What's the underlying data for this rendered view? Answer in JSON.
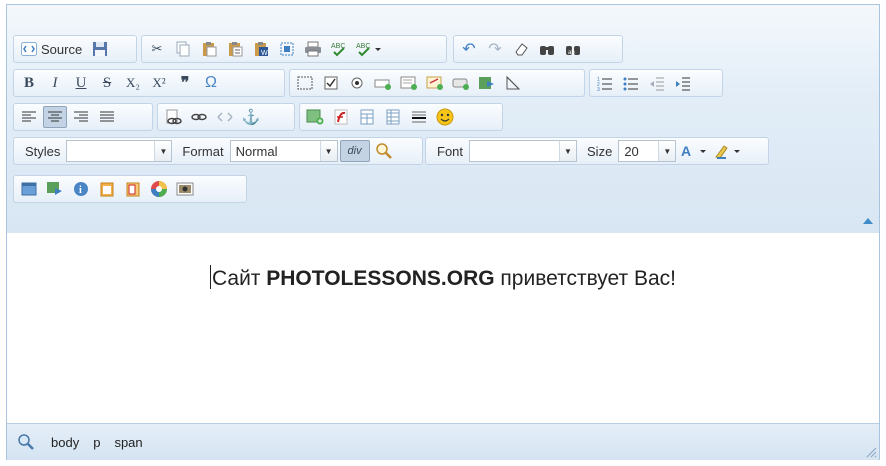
{
  "toolbar": {
    "source_label": "Source",
    "styles": {
      "label": "Styles",
      "value": ""
    },
    "format": {
      "label": "Format",
      "value": "Normal"
    },
    "font": {
      "label": "Font",
      "value": ""
    },
    "size": {
      "label": "Size",
      "value": "20"
    },
    "bold_glyph": "B",
    "italic_glyph": "I",
    "underline_glyph": "U",
    "strike_glyph": "S",
    "subscript_glyph": "X₂",
    "superscript_glyph": "X²",
    "blockquote_glyph": "❞",
    "special_char_glyph": "Ω",
    "div_glyph": "div"
  },
  "content": {
    "text_before": "Сайт ",
    "text_bold": "PHOTOLESSONS.ORG",
    "text_after": " приветствует Вас!"
  },
  "statusbar": {
    "path": [
      "body",
      "p",
      "span"
    ]
  },
  "colors": {
    "accent": "#3e8bc7",
    "toolbar_bg": "#dde9f5",
    "border": "#a9c4de"
  }
}
